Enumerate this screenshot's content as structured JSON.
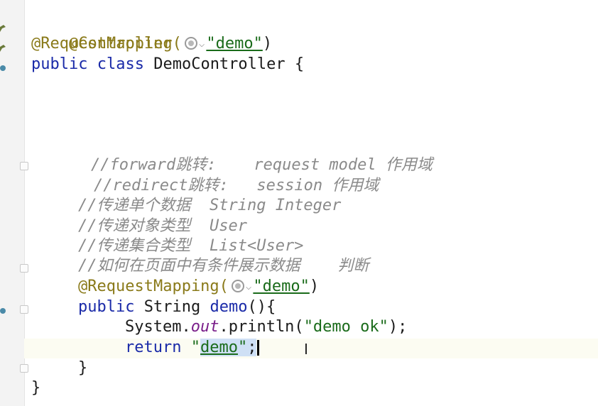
{
  "gutter": {
    "icons": [
      "bean-annotation-icon",
      "request-mapping-icon",
      "class-bean-icon",
      "method-mapping-icon"
    ]
  },
  "code": {
    "annotation_controller": "@Controller",
    "annotation_request_mapping": "@RequestMapping(",
    "mapping_value_class": "\"demo\"",
    "mapping_close_class": ")",
    "class_kw_public": "public",
    "class_kw_class": "class",
    "class_name": "DemoController {",
    "comment_forward": "//forward跳转:    request model 作用域",
    "comment_redirect": "//redirect跳转:   session 作用域",
    "comment_single": "//传递单个数据  String Integer",
    "comment_object": "//传递对象类型  User",
    "comment_collection": "//传递集合类型  List<User>",
    "comment_condition": "//如何在页面中有条件展示数据    判断",
    "method_annotation": "@RequestMapping(",
    "mapping_value_method": "\"demo\"",
    "mapping_close_method": ")",
    "method_kw_public": "public",
    "method_return_type": "String",
    "method_name": "demo",
    "method_sig_rest": "(){",
    "println_obj": "System.",
    "println_field": "out",
    "println_call": ".println(",
    "println_arg": "\"demo ok\"",
    "println_end": ");",
    "return_kw": "return",
    "return_quote_open": "\"",
    "return_value": "demo",
    "return_quote_close": "\"",
    "return_semicolon": ";",
    "method_close": "}",
    "class_close": "}"
  }
}
